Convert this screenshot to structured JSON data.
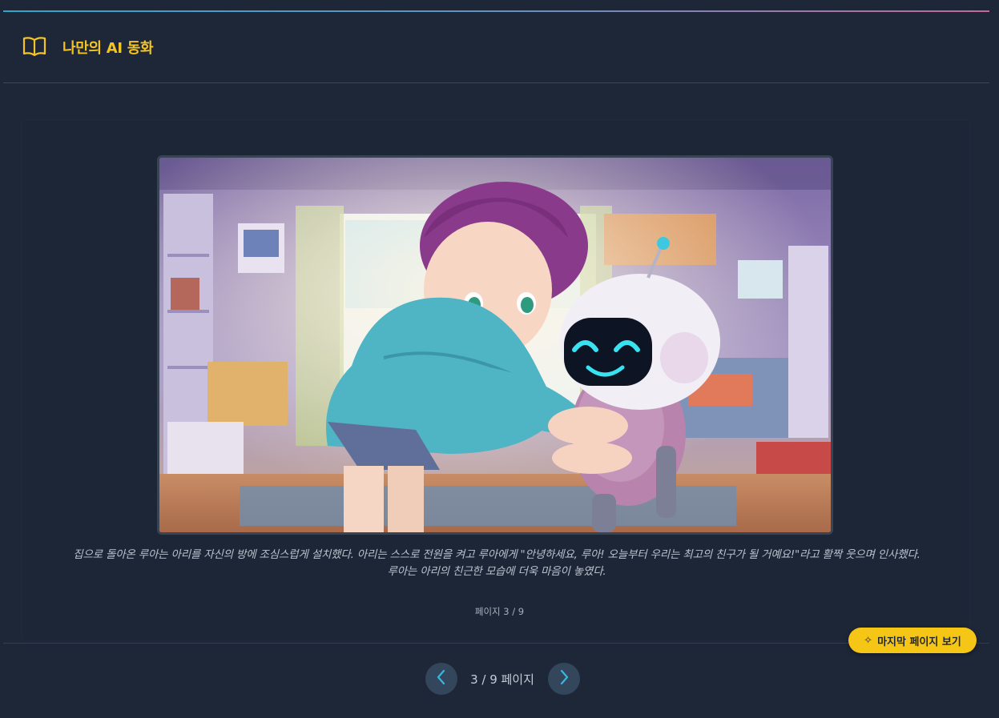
{
  "header": {
    "title": "나만의 AI 동화",
    "icon": "open-book-icon"
  },
  "story": {
    "illustration": "girl-with-robot-illustration",
    "text_line1": "집으로 돌아온 루아는 아리를 자신의 방에 조심스럽게 설치했다. 아리는 스스로 전원을 켜고 루아에게 \"안녕하세요, 루아! 오늘부터 우리는 최고의 친구가 될 거예요!\"라고 활짝 웃으며 인사했다.",
    "text_line2": "루아는 아리의 친근한 모습에 더욱 마음이 놓였다.",
    "page_caption": "페이지 3 / 9"
  },
  "actions": {
    "magic_button_label": "마지막 페이지 보기",
    "magic_button_icon": "sparkle-icon"
  },
  "pagination": {
    "indicator": "3 / 9 페이지",
    "current": 3,
    "total": 9,
    "prev_icon": "chevron-left-icon",
    "next_icon": "chevron-right-icon"
  },
  "colors": {
    "background": "#1e2738",
    "accent": "#f4c425",
    "nav_button": "#34465c",
    "nav_chevron": "#3ab6e0"
  }
}
